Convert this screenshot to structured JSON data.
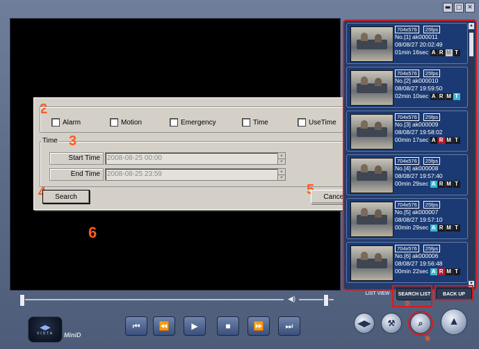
{
  "window": {
    "controls": [
      "▬",
      "□",
      "✕"
    ]
  },
  "annotations": {
    "n2": "2",
    "n3": "3",
    "n4": "4",
    "n5": "5",
    "n6": "6",
    "n7": "⑦",
    "n8": "⑧"
  },
  "dialog": {
    "checkboxes": [
      "Alarm",
      "Motion",
      "Emergency",
      "Time",
      "UseTime"
    ],
    "time_group_label": "Time",
    "start_label": "Start Time",
    "start_value": "2008-08-25 00:00",
    "end_label": "End Time",
    "end_value": "2008-08-25 23:59",
    "search_button": "Search",
    "cancel_button": "Cancel"
  },
  "list": {
    "items": [
      {
        "res": "704x576",
        "fps": "25fps",
        "id": "No.[1] ak000011",
        "datetime": "08/08/27 20:02:49",
        "duration": "01min 16sec",
        "flags": [
          "A",
          "R",
          "M",
          "T"
        ],
        "flag_colors": [
          "#ffffff",
          "#ffffff",
          "#7b7b7b",
          "#ffffff"
        ],
        "flag_bg": [
          "#1a1a1a",
          "#1a1a1a",
          "#c8c8c8",
          "#1a1a1a"
        ]
      },
      {
        "res": "704x576",
        "fps": "25fps",
        "id": "No.[2] ak000010",
        "datetime": "08/08/27 19:59:50",
        "duration": "02min 10sec",
        "flags": [
          "A",
          "R",
          "M",
          "T"
        ],
        "flag_colors": [
          "#ffffff",
          "#ffffff",
          "#ffffff",
          "#ffffff"
        ],
        "flag_bg": [
          "#1a1a1a",
          "#1a1a1a",
          "#1a1a1a",
          "#37b8d8"
        ]
      },
      {
        "res": "704x576",
        "fps": "25fps",
        "id": "No.[3] ak000009",
        "datetime": "08/08/27 19:58:02",
        "duration": "00min 17sec",
        "flags": [
          "A",
          "R",
          "M",
          "T"
        ],
        "flag_colors": [
          "#ffffff",
          "#ffffff",
          "#ffffff",
          "#ffffff"
        ],
        "flag_bg": [
          "#1a1a1a",
          "#b2182b",
          "#1a1a1a",
          "#1a1a1a"
        ]
      },
      {
        "res": "704x576",
        "fps": "25fps",
        "id": "No.[4] ak000008",
        "datetime": "08/08/27 19:57:40",
        "duration": "00min 29sec",
        "flags": [
          "A",
          "R",
          "M",
          "T"
        ],
        "flag_colors": [
          "#ffffff",
          "#ffffff",
          "#ffffff",
          "#ffffff"
        ],
        "flag_bg": [
          "#37b8d8",
          "#1a1a1a",
          "#1a1a1a",
          "#1a1a1a"
        ]
      },
      {
        "res": "704x576",
        "fps": "25fps",
        "id": "No.[5] ak000007",
        "datetime": "08/08/27 19:57:10",
        "duration": "00min 29sec",
        "flags": [
          "A",
          "R",
          "M",
          "T"
        ],
        "flag_colors": [
          "#ffffff",
          "#ffffff",
          "#ffffff",
          "#ffffff"
        ],
        "flag_bg": [
          "#37b8d8",
          "#1a1a1a",
          "#1a1a1a",
          "#1a1a1a"
        ]
      },
      {
        "res": "704x576",
        "fps": "25fps",
        "id": "No.[6] ak000006",
        "datetime": "08/08/27 19:56:48",
        "duration": "00min 22sec",
        "flags": [
          "A",
          "R",
          "M",
          "T"
        ],
        "flag_colors": [
          "#ffffff",
          "#ffffff",
          "#ffffff",
          "#ffffff"
        ],
        "flag_bg": [
          "#37b8d8",
          "#b2182b",
          "#1a1a1a",
          "#1a1a1a"
        ]
      }
    ]
  },
  "tabs": {
    "list_view": "LIST VIEW",
    "search_list": "SEARCH LIST",
    "back_up": "BACK UP"
  },
  "logo": {
    "brand": "VISTA",
    "product": "MiniD"
  },
  "playback": [
    "⏮",
    "⏪",
    "▶",
    "■",
    "⏩",
    "⏭"
  ],
  "colors": {
    "accent_red": "#d81b1b",
    "annotation_orange": "#ff5a1f",
    "panel_blue": "#1b3a73"
  }
}
